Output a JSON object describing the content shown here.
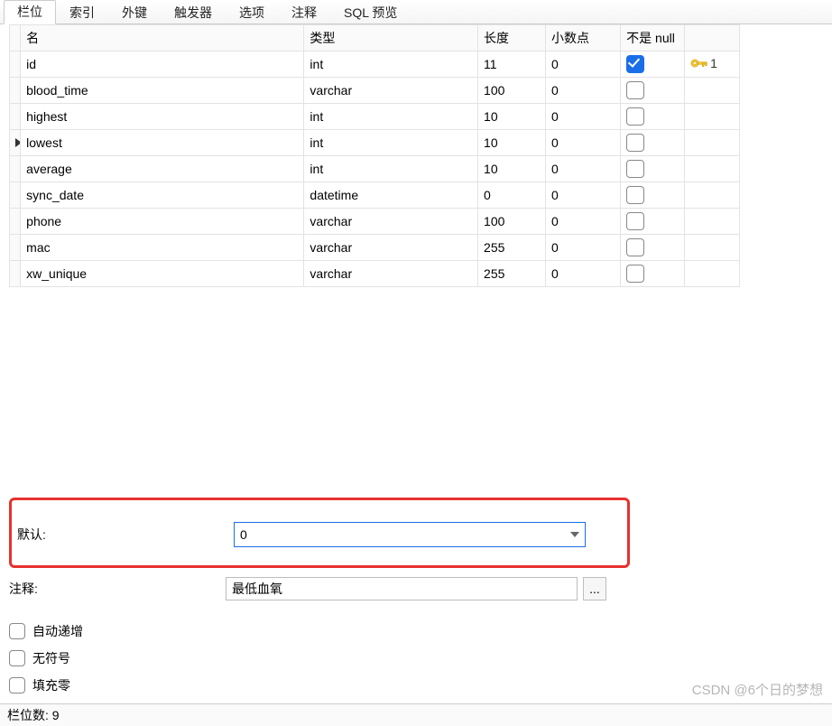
{
  "tabs": {
    "items": [
      "栏位",
      "索引",
      "外键",
      "触发器",
      "选项",
      "注释",
      "SQL 预览"
    ],
    "active_index": 0
  },
  "columns_grid": {
    "headers": {
      "name": "名",
      "type": "类型",
      "length": "长度",
      "decimals": "小数点",
      "not_null": "不是 null"
    },
    "active_row_index": 3,
    "rows": [
      {
        "name": "id",
        "type": "int",
        "length": "11",
        "decimals": "0",
        "not_null": true,
        "key": "1"
      },
      {
        "name": "blood_time",
        "type": "varchar",
        "length": "100",
        "decimals": "0",
        "not_null": false
      },
      {
        "name": "highest",
        "type": "int",
        "length": "10",
        "decimals": "0",
        "not_null": false
      },
      {
        "name": "lowest",
        "type": "int",
        "length": "10",
        "decimals": "0",
        "not_null": false
      },
      {
        "name": "average",
        "type": "int",
        "length": "10",
        "decimals": "0",
        "not_null": false
      },
      {
        "name": "sync_date",
        "type": "datetime",
        "length": "0",
        "decimals": "0",
        "not_null": false
      },
      {
        "name": "phone",
        "type": "varchar",
        "length": "100",
        "decimals": "0",
        "not_null": false
      },
      {
        "name": "mac",
        "type": "varchar",
        "length": "255",
        "decimals": "0",
        "not_null": false
      },
      {
        "name": "xw_unique",
        "type": "varchar",
        "length": "255",
        "decimals": "0",
        "not_null": false
      }
    ]
  },
  "detail": {
    "default_label": "默认:",
    "default_value": "0",
    "comment_label": "注释:",
    "comment_value": "最低血氧",
    "ellipsis": "...",
    "checks": {
      "auto_increment": "自动递增",
      "unsigned": "无符号",
      "zerofill": "填充零"
    }
  },
  "statusbar": {
    "count_label": "栏位数:",
    "count_value": "9"
  },
  "watermark": "CSDN @6个日的梦想"
}
